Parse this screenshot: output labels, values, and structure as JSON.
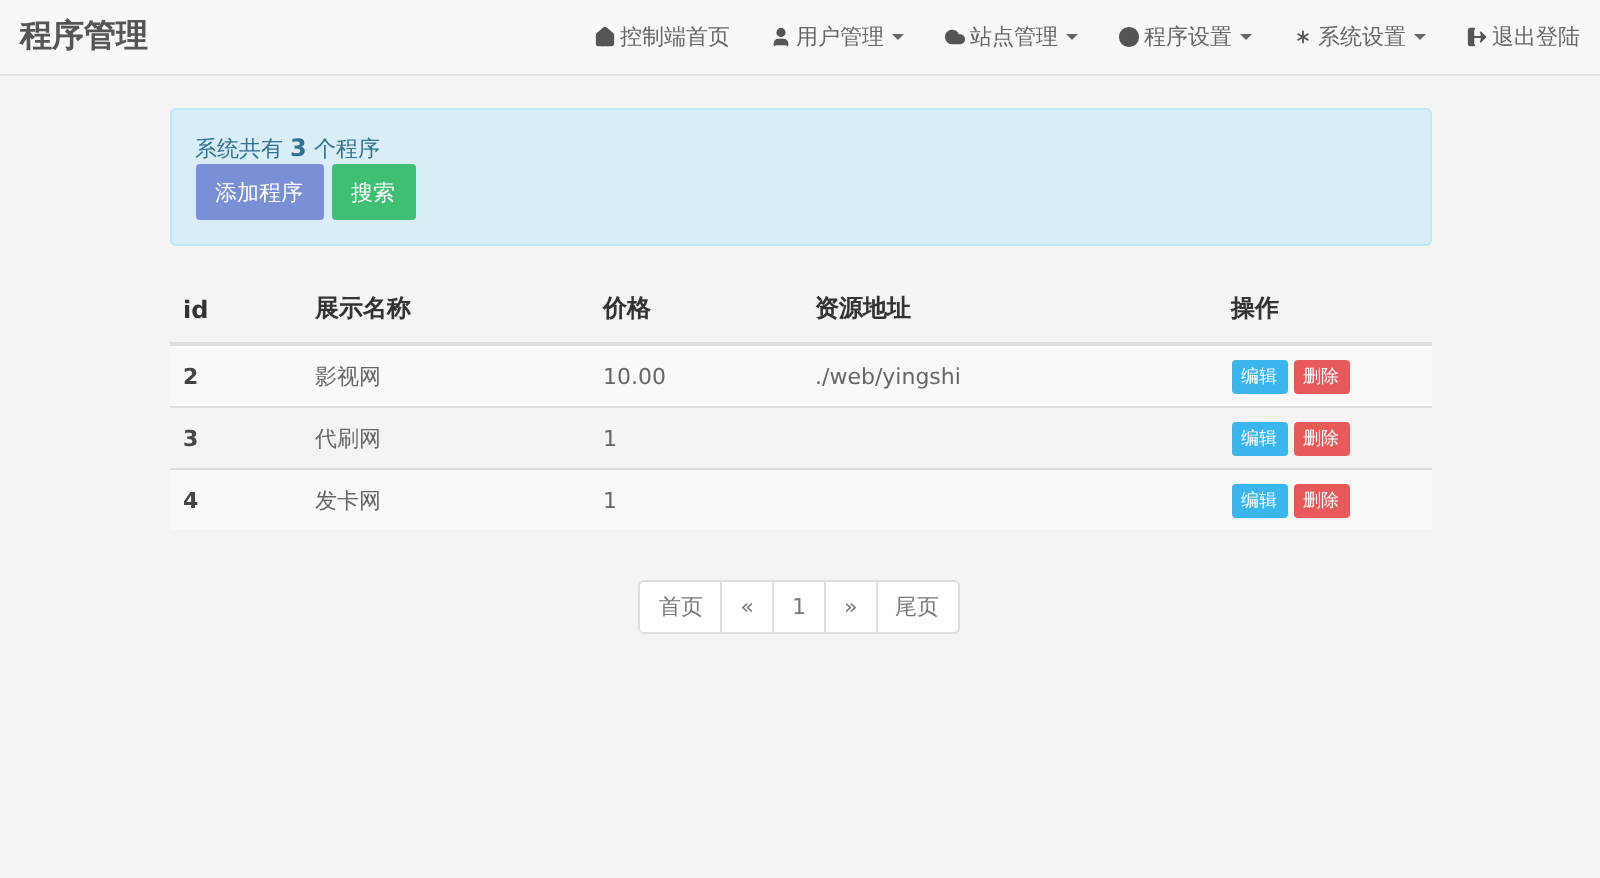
{
  "brand": "程序管理",
  "nav": [
    {
      "label": "控制端首页",
      "dropdown": false
    },
    {
      "label": "用户管理",
      "dropdown": true
    },
    {
      "label": "站点管理",
      "dropdown": true
    },
    {
      "label": "程序设置",
      "dropdown": true
    },
    {
      "label": "系统设置",
      "dropdown": true
    },
    {
      "label": "退出登陆",
      "dropdown": false
    }
  ],
  "alert": {
    "text": "系统共有 **3** 个程序",
    "buttons": [
      {
        "label": "添加程序",
        "kind": "primary"
      },
      {
        "label": "搜索",
        "kind": "success"
      }
    ]
  },
  "table": {
    "columns": [
      "id",
      "展示名称",
      "价格",
      "资源地址",
      "操作"
    ],
    "rows": [
      {
        "id": "2",
        "name": "影视网",
        "price": "10.00",
        "address": "./web/yingshi",
        "actions": [
          {
            "label": "编辑",
            "kind": "info"
          },
          {
            "label": "删除",
            "kind": "danger"
          }
        ]
      },
      {
        "id": "3",
        "name": "代刷网",
        "price": "1",
        "actions": [
          {
            "label": "编辑",
            "kind": "info"
          },
          {
            "label": "删除",
            "kind": "danger"
          }
        ]
      },
      {
        "id": "4",
        "name": "发卡网",
        "price": "1",
        "actions": [
          {
            "label": "编辑",
            "kind": "info"
          },
          {
            "label": "删除",
            "kind": "danger"
          }
        ]
      }
    ]
  },
  "pagination": [
    {
      "label": "首页",
      "selected": false
    },
    {
      "label": "«",
      "selected": false
    },
    {
      "label": "1",
      "selected": false
    },
    {
      "label": "»",
      "selected": false
    },
    {
      "label": "尾页",
      "selected": false
    }
  ]
}
